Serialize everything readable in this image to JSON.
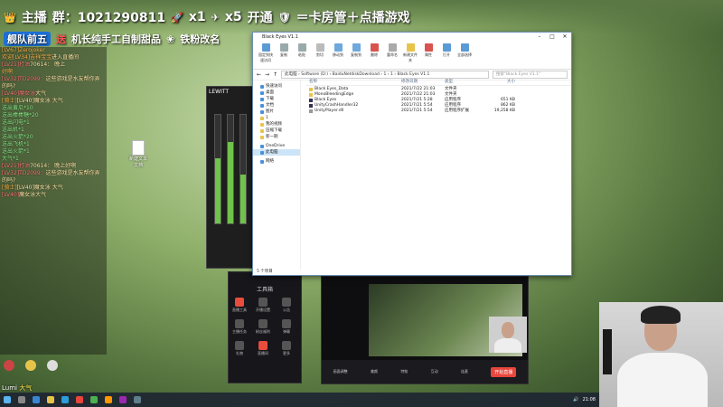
{
  "banner": {
    "logo_text": "主播",
    "qq_label": "群：1021290811",
    "rocket_count": "x1",
    "plane_count": "x5",
    "open_label": "开通",
    "open_suffix": "＝卡房管＋点播游戏",
    "line2_a": "舰队前五",
    "line2_b": "送",
    "line2_c": "机长纯手工自制甜品",
    "line2_d": "铁粉改名"
  },
  "chat": [
    {
      "name": "[LV67]Zerojoker",
      "text": ""
    },
    {
      "name": "欢迎[LV34]吉祥宝宝",
      "text": "进入直播间"
    },
    {
      "name": "",
      "text": ""
    },
    {
      "name": "[LV21]打油",
      "text": "70614： 晚上"
    },
    {
      "name": "好啊",
      "text": ""
    },
    {
      "name": "[LV32]TD2099：",
      "text": "这些游戏是水友帮你弄的吗?"
    },
    {
      "name": "[LV40]魔女泳",
      "text": "大气"
    },
    {
      "name": "[骑士]",
      "text": "[LV40]魔女泳 大气"
    },
    {
      "name": "",
      "text": "送出黄瓜*10"
    },
    {
      "name": "",
      "text": "送出棒棒糖*20"
    },
    {
      "name": "",
      "text": "送出闪电*1"
    },
    {
      "name": "",
      "text": "送出机*1"
    },
    {
      "name": "",
      "text": "送出火箭*20"
    },
    {
      "name": "",
      "text": "送出飞机*1"
    },
    {
      "name": "",
      "text": "送出火箭*1"
    },
    {
      "name": "",
      "text": "大气*1"
    },
    {
      "name": "[LV21]打油",
      "text": "70614： 晚上好啊"
    },
    {
      "name": "[LV32]TD2099：",
      "text": "这些游戏是水友帮你弄的吗?"
    },
    {
      "name": "[骑士]",
      "text": "[LV40]魔女泳 大气"
    },
    {
      "name": "[LV40]",
      "text": "魔女泳大气"
    }
  ],
  "desktop_file": {
    "label": "新建文本文档"
  },
  "mixer": {
    "title": "LEWITT"
  },
  "app_panel": {
    "title": "工具箱",
    "tiles": [
      "直播工具",
      "开播设置",
      "公告",
      "主播任务",
      "粉丝福利",
      "弹幕",
      "礼物",
      "直播间",
      "更多"
    ]
  },
  "preview_bar": {
    "items": [
      "画面调整",
      "美颜",
      "特效",
      "互动",
      "连麦"
    ],
    "start_label": "开始直播"
  },
  "explorer": {
    "title": "Black Eyes V1.1",
    "ribbon": [
      "固定到快速访问",
      "复制",
      "粘贴",
      "剪切",
      "移动到",
      "复制到",
      "删除",
      "重命名",
      "新建文件夹",
      "属性",
      "打开",
      "全部选择"
    ],
    "address": "此电脑 › Software (D:) › BaiduNetdiskDownload › 1 › 1 › Black Eyes V1.1",
    "search_placeholder": "搜索\"Black Eyes V1.1\"",
    "nav": [
      "快速访问",
      "桌面",
      "下载",
      "文档",
      "图片",
      "1",
      "我的视频",
      "压缩下载",
      "新一期",
      "OneDrive",
      "此电脑",
      "网络"
    ],
    "nav_selected": "此电脑",
    "headers": {
      "name": "名称",
      "date": "修改日期",
      "type": "类型",
      "size": "大小"
    },
    "files": [
      {
        "name": "Black Eyes_Data",
        "date": "2021/7/22 21:03",
        "type": "文件夹",
        "size": "",
        "kind": "folder"
      },
      {
        "name": "MonoBleedingEdge",
        "date": "2021/7/22 21:03",
        "type": "文件夹",
        "size": "",
        "kind": "folder"
      },
      {
        "name": "Black Eyes",
        "date": "2021/7/21 5:28",
        "type": "应用程序",
        "size": "651 KB",
        "kind": "app"
      },
      {
        "name": "UnityCrashHandler32",
        "date": "2021/7/21 5:54",
        "type": "应用程序",
        "size": "862 KB",
        "kind": "app"
      },
      {
        "name": "UnityPlayer.dll",
        "date": "2021/7/21 5:54",
        "type": "应用程序扩展",
        "size": "19,258 KB",
        "kind": "dll"
      }
    ],
    "status": "5 个项目"
  },
  "gift_line": {
    "name": "Lumi",
    "action": "大气"
  },
  "tray": {
    "time": "21:08"
  },
  "colors": {
    "accent": "#1d6fd6",
    "live_red": "#e8463c",
    "folder": "#e8c34a"
  }
}
